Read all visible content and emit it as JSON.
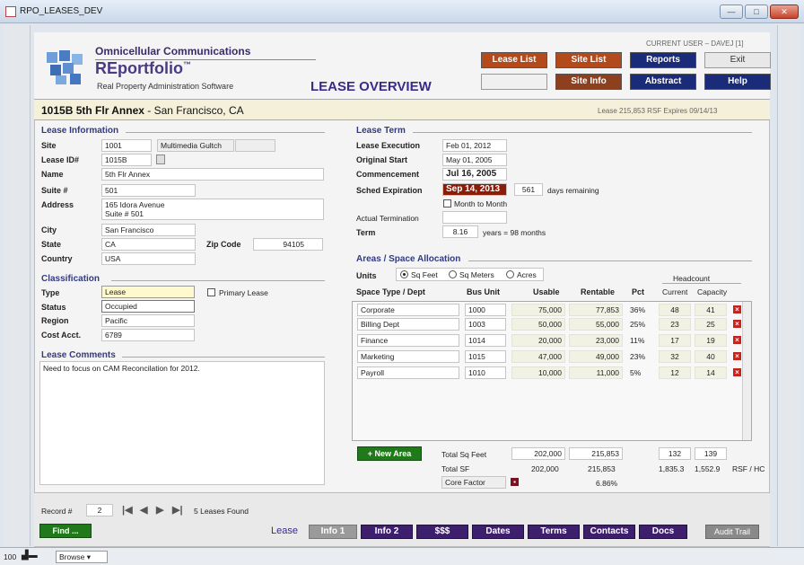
{
  "window": {
    "title": "RPO_LEASES_DEV",
    "minimize": "—",
    "maximize": "□",
    "close": "✕"
  },
  "header": {
    "company": "Omnicellular Communications",
    "product": "REportfolio",
    "trademark": "™",
    "tagline": "Real Property Administration Software",
    "screen_title": "LEASE OVERVIEW",
    "current_user": "CURRENT USER – DAVEJ [1]"
  },
  "nav": {
    "lease_list": "Lease List",
    "site_list": "Site List",
    "reports": "Reports",
    "exit": "Exit",
    "site_info": "Site Info",
    "abstract": "Abstract",
    "help": "Help"
  },
  "banner": {
    "lease_id": "1015B 5th Flr Annex",
    "separator": " - ",
    "location": "San Francisco, CA",
    "summary": "Lease 215,853 RSF  Expires 09/14/13"
  },
  "lease_info": {
    "heading": "Lease Information",
    "site_label": "Site",
    "site": "1001",
    "site_name": "Multimedia Gultch",
    "lease_id_label": "Lease ID#",
    "lease_id": "1015B",
    "name_label": "Name",
    "name": "5th Flr Annex",
    "suite_label": "Suite #",
    "suite": "501",
    "address_label": "Address",
    "address1": "165 Idora Avenue",
    "address2": "Suite # 501",
    "city_label": "City",
    "city": "San Francisco",
    "state_label": "State",
    "state": "CA",
    "zip_label": "Zip Code",
    "zip": "94105",
    "country_label": "Country",
    "country": "USA"
  },
  "classification": {
    "heading": "Classification",
    "type_label": "Type",
    "type": "Lease",
    "primary_lease": "Primary Lease",
    "status_label": "Status",
    "status": "Occupied",
    "region_label": "Region",
    "region": "Pacific",
    "cost_label": "Cost Acct.",
    "cost": "6789"
  },
  "comments": {
    "heading": "Lease Comments",
    "text": "Need to focus on CAM Reconcilation for 2012."
  },
  "lease_term": {
    "heading": "Lease Term",
    "execution_label": "Lease Execution",
    "execution": "Feb 01, 2012",
    "original_label": "Original Start",
    "original": "May 01, 2005",
    "commencement_label": "Commencement",
    "commencement": "Jul 16, 2005",
    "sched_label": "Sched Expiration",
    "sched": "Sep 14, 2013",
    "days_remaining": "561",
    "days_label": "days remaining",
    "month_to_month": "Month to Month",
    "actual_label": "Actual Termination",
    "term_label": "Term",
    "term": "8.16",
    "term_unit": "years = 98 months"
  },
  "areas": {
    "heading": "Areas / Space Allocation",
    "units_label": "Units",
    "unit_options": [
      "Sq Feet",
      "Sq Meters",
      "Acres"
    ],
    "headcount": "Headcount",
    "columns": [
      "Space Type / Dept",
      "Bus Unit",
      "Usable",
      "Rentable",
      "Pct",
      "Current",
      "Capacity"
    ],
    "rows": [
      {
        "dept": "Corporate",
        "bu": "1000",
        "usable": "75,000",
        "rentable": "77,853",
        "pct": "36%",
        "current": "48",
        "capacity": "41"
      },
      {
        "dept": "Billing Dept",
        "bu": "1003",
        "usable": "50,000",
        "rentable": "55,000",
        "pct": "25%",
        "current": "23",
        "capacity": "25"
      },
      {
        "dept": "Finance",
        "bu": "1014",
        "usable": "20,000",
        "rentable": "23,000",
        "pct": "11%",
        "current": "17",
        "capacity": "19"
      },
      {
        "dept": "Marketing",
        "bu": "1015",
        "usable": "47,000",
        "rentable": "49,000",
        "pct": "23%",
        "current": "32",
        "capacity": "40"
      },
      {
        "dept": "Payroll",
        "bu": "1010",
        "usable": "10,000",
        "rentable": "11,000",
        "pct": "5%",
        "current": "12",
        "capacity": "14"
      }
    ],
    "new_area": "+ New Area",
    "total_sqft_label": "Total Sq Feet",
    "total_usable": "202,000",
    "total_rentable": "215,853",
    "total_current": "132",
    "total_capacity": "139",
    "total_sf_label": "Total SF",
    "sf_usable": "202,000",
    "sf_rentable": "215,853",
    "rsf_hc1": "1,835.3",
    "rsf_hc2": "1,552.9",
    "rsf_hc_label": "RSF / HC",
    "core_factor_label": "Core Factor",
    "core_factor": "6.86%"
  },
  "footer": {
    "record_label": "Record #",
    "record": "2",
    "found": "5 Leases Found",
    "find": "Find ...",
    "lease_label": "Lease",
    "tabs": [
      "Info 1",
      "Info 2",
      "$$$",
      "Dates",
      "Terms",
      "Contacts",
      "Docs"
    ],
    "audit": "Audit Trail"
  },
  "status_bar": {
    "zoom": "100",
    "mode": "Browse"
  }
}
